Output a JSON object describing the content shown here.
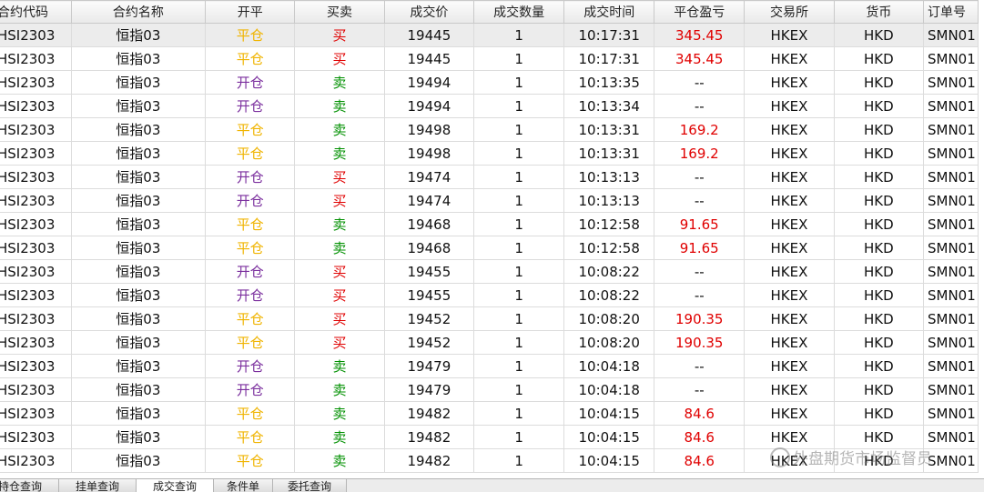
{
  "columns": [
    "合约代码",
    "合约名称",
    "开平",
    "买卖",
    "成交价",
    "成交数量",
    "成交时间",
    "平仓盈亏",
    "交易所",
    "货币",
    "订单号"
  ],
  "colors": {
    "ping": "#f0b400",
    "kai": "#7b2f9e",
    "buy": "#e00000",
    "sell": "#009000",
    "profit": "#e00000"
  },
  "rows": [
    {
      "code": "HSI2303",
      "name": "恒指03",
      "oc": "平仓",
      "bs": "买",
      "price": "19445",
      "qty": "1",
      "time": "10:17:31",
      "pnl": "345.45",
      "exch": "HKEX",
      "cur": "HKD",
      "oid": "SMN01"
    },
    {
      "code": "HSI2303",
      "name": "恒指03",
      "oc": "平仓",
      "bs": "买",
      "price": "19445",
      "qty": "1",
      "time": "10:17:31",
      "pnl": "345.45",
      "exch": "HKEX",
      "cur": "HKD",
      "oid": "SMN01"
    },
    {
      "code": "HSI2303",
      "name": "恒指03",
      "oc": "开仓",
      "bs": "卖",
      "price": "19494",
      "qty": "1",
      "time": "10:13:35",
      "pnl": "--",
      "exch": "HKEX",
      "cur": "HKD",
      "oid": "SMN01"
    },
    {
      "code": "HSI2303",
      "name": "恒指03",
      "oc": "开仓",
      "bs": "卖",
      "price": "19494",
      "qty": "1",
      "time": "10:13:34",
      "pnl": "--",
      "exch": "HKEX",
      "cur": "HKD",
      "oid": "SMN01"
    },
    {
      "code": "HSI2303",
      "name": "恒指03",
      "oc": "平仓",
      "bs": "卖",
      "price": "19498",
      "qty": "1",
      "time": "10:13:31",
      "pnl": "169.2",
      "exch": "HKEX",
      "cur": "HKD",
      "oid": "SMN01"
    },
    {
      "code": "HSI2303",
      "name": "恒指03",
      "oc": "平仓",
      "bs": "卖",
      "price": "19498",
      "qty": "1",
      "time": "10:13:31",
      "pnl": "169.2",
      "exch": "HKEX",
      "cur": "HKD",
      "oid": "SMN01"
    },
    {
      "code": "HSI2303",
      "name": "恒指03",
      "oc": "开仓",
      "bs": "买",
      "price": "19474",
      "qty": "1",
      "time": "10:13:13",
      "pnl": "--",
      "exch": "HKEX",
      "cur": "HKD",
      "oid": "SMN01"
    },
    {
      "code": "HSI2303",
      "name": "恒指03",
      "oc": "开仓",
      "bs": "买",
      "price": "19474",
      "qty": "1",
      "time": "10:13:13",
      "pnl": "--",
      "exch": "HKEX",
      "cur": "HKD",
      "oid": "SMN01"
    },
    {
      "code": "HSI2303",
      "name": "恒指03",
      "oc": "平仓",
      "bs": "卖",
      "price": "19468",
      "qty": "1",
      "time": "10:12:58",
      "pnl": "91.65",
      "exch": "HKEX",
      "cur": "HKD",
      "oid": "SMN01"
    },
    {
      "code": "HSI2303",
      "name": "恒指03",
      "oc": "平仓",
      "bs": "卖",
      "price": "19468",
      "qty": "1",
      "time": "10:12:58",
      "pnl": "91.65",
      "exch": "HKEX",
      "cur": "HKD",
      "oid": "SMN01"
    },
    {
      "code": "HSI2303",
      "name": "恒指03",
      "oc": "开仓",
      "bs": "买",
      "price": "19455",
      "qty": "1",
      "time": "10:08:22",
      "pnl": "--",
      "exch": "HKEX",
      "cur": "HKD",
      "oid": "SMN01"
    },
    {
      "code": "HSI2303",
      "name": "恒指03",
      "oc": "开仓",
      "bs": "买",
      "price": "19455",
      "qty": "1",
      "time": "10:08:22",
      "pnl": "--",
      "exch": "HKEX",
      "cur": "HKD",
      "oid": "SMN01"
    },
    {
      "code": "HSI2303",
      "name": "恒指03",
      "oc": "平仓",
      "bs": "买",
      "price": "19452",
      "qty": "1",
      "time": "10:08:20",
      "pnl": "190.35",
      "exch": "HKEX",
      "cur": "HKD",
      "oid": "SMN01"
    },
    {
      "code": "HSI2303",
      "name": "恒指03",
      "oc": "平仓",
      "bs": "买",
      "price": "19452",
      "qty": "1",
      "time": "10:08:20",
      "pnl": "190.35",
      "exch": "HKEX",
      "cur": "HKD",
      "oid": "SMN01"
    },
    {
      "code": "HSI2303",
      "name": "恒指03",
      "oc": "开仓",
      "bs": "卖",
      "price": "19479",
      "qty": "1",
      "time": "10:04:18",
      "pnl": "--",
      "exch": "HKEX",
      "cur": "HKD",
      "oid": "SMN01"
    },
    {
      "code": "HSI2303",
      "name": "恒指03",
      "oc": "开仓",
      "bs": "卖",
      "price": "19479",
      "qty": "1",
      "time": "10:04:18",
      "pnl": "--",
      "exch": "HKEX",
      "cur": "HKD",
      "oid": "SMN01"
    },
    {
      "code": "HSI2303",
      "name": "恒指03",
      "oc": "平仓",
      "bs": "卖",
      "price": "19482",
      "qty": "1",
      "time": "10:04:15",
      "pnl": "84.6",
      "exch": "HKEX",
      "cur": "HKD",
      "oid": "SMN01"
    },
    {
      "code": "HSI2303",
      "name": "恒指03",
      "oc": "平仓",
      "bs": "卖",
      "price": "19482",
      "qty": "1",
      "time": "10:04:15",
      "pnl": "84.6",
      "exch": "HKEX",
      "cur": "HKD",
      "oid": "SMN01"
    },
    {
      "code": "HSI2303",
      "name": "恒指03",
      "oc": "平仓",
      "bs": "卖",
      "price": "19482",
      "qty": "1",
      "time": "10:04:15",
      "pnl": "84.6",
      "exch": "HKEX",
      "cur": "HKD",
      "oid": "SMN01"
    }
  ],
  "tabs": [
    {
      "label": "持仓查询",
      "active": false
    },
    {
      "label": "挂单查询",
      "active": false
    },
    {
      "label": "成交查询",
      "active": true
    },
    {
      "label": "条件单",
      "active": false
    },
    {
      "label": "委托查询",
      "active": false
    }
  ],
  "watermark": "外盘期货市场监督员"
}
